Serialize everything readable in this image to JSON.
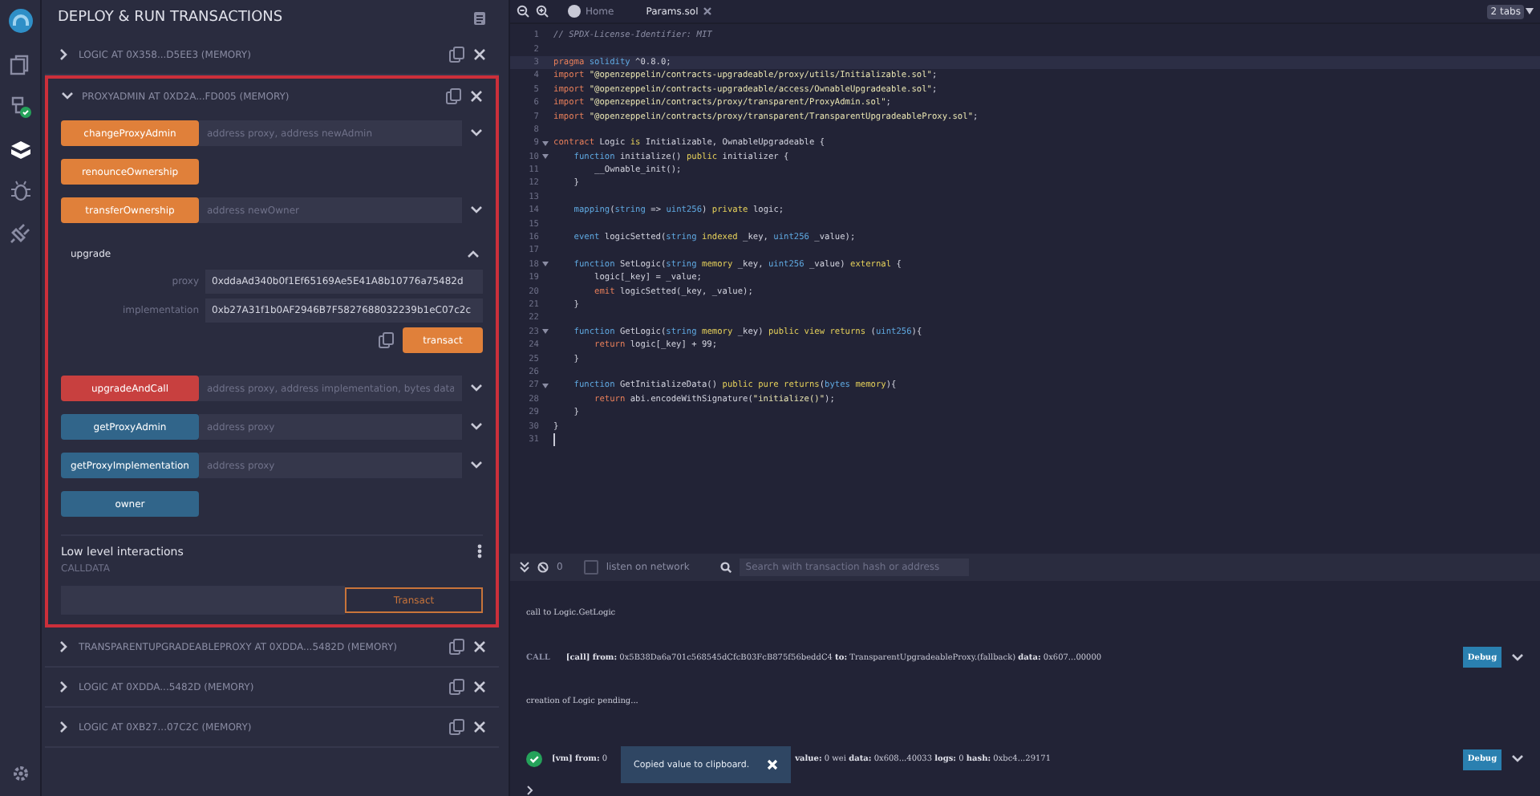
{
  "sidebar": {
    "items": [
      {
        "kind": "files",
        "selected": false
      },
      {
        "kind": "compiler",
        "selected": false
      },
      {
        "kind": "deploy",
        "selected": true
      },
      {
        "kind": "debugger",
        "selected": false
      },
      {
        "kind": "plugins",
        "selected": false
      }
    ]
  },
  "panel": {
    "title": "DEPLOY & RUN TRANSACTIONS",
    "instances": [
      {
        "title": "LOGIC AT 0X358...D5EE3 (MEMORY)",
        "expanded": false,
        "highlighted": false
      },
      {
        "title": "PROXYADMIN AT 0XD2A...FD005 (MEMORY)",
        "expanded": true,
        "highlighted": true,
        "functions": [
          {
            "name": "changeProxyAdmin",
            "kind": "transact",
            "placeholder": "address proxy, address newAdmin",
            "expanded": false
          },
          {
            "name": "renounceOwnership",
            "kind": "transact"
          },
          {
            "name": "transferOwnership",
            "kind": "transact",
            "placeholder": "address newOwner",
            "expanded": false
          },
          {
            "name": "upgrade",
            "kind": "transact",
            "expanded": true,
            "params": [
              {
                "label": "proxy",
                "value": "0xddaAd340b0f1Ef65169Ae5E41A8b10776a75482d"
              },
              {
                "label": "implementation",
                "value": "0xb27A31f1b0AF2946B7F5827688032239b1eC07c2c"
              }
            ],
            "action": "transact"
          },
          {
            "name": "upgradeAndCall",
            "kind": "payable",
            "placeholder": "address proxy, address implementation, bytes data",
            "expanded": false
          },
          {
            "name": "getProxyAdmin",
            "kind": "call",
            "placeholder": "address proxy",
            "expanded": false
          },
          {
            "name": "getProxyImplementation",
            "kind": "call",
            "placeholder": "address proxy",
            "expanded": false
          },
          {
            "name": "owner",
            "kind": "call"
          }
        ],
        "low_level": {
          "title": "Low level interactions",
          "calldata_label": "CALLDATA",
          "button": "Transact"
        }
      },
      {
        "title": "TRANSPARENTUPGRADEABLEPROXY AT 0XDDA...5482D (MEMORY)",
        "expanded": false,
        "highlighted": false
      },
      {
        "title": "LOGIC AT 0XDDA...5482D (MEMORY)",
        "expanded": false,
        "highlighted": false
      },
      {
        "title": "LOGIC AT 0XB27...07C2C (MEMORY)",
        "expanded": false,
        "highlighted": false
      }
    ]
  },
  "editor": {
    "tabs": [
      {
        "label": "Home",
        "kind": "home",
        "selected": false
      },
      {
        "label": "Params.sol",
        "kind": "file",
        "selected": true
      }
    ],
    "tab_count": "2 tabs",
    "lines": [
      {
        "number": "1",
        "segments": [
          {
            "kind": "comment",
            "text": "// SPDX-License-Identifier: MIT"
          }
        ]
      },
      {
        "number": "2"
      },
      {
        "number": "3",
        "active": true,
        "segments": [
          {
            "kind": "keyword",
            "text": "pragma "
          },
          {
            "kind": "type",
            "text": "solidity"
          },
          {
            "kind": "plain",
            "text": " ^0.8.0;"
          }
        ]
      },
      {
        "number": "4",
        "segments": [
          {
            "kind": "keyword",
            "text": "import "
          },
          {
            "kind": "string",
            "text": "\"@openzeppelin/contracts-upgradeable/proxy/utils/Initializable.sol\""
          },
          {
            "kind": "plain",
            "text": ";"
          }
        ]
      },
      {
        "number": "5",
        "segments": [
          {
            "kind": "keyword",
            "text": "import "
          },
          {
            "kind": "string",
            "text": "\"@openzeppelin/contracts-upgradeable/access/OwnableUpgradeable.sol\""
          },
          {
            "kind": "plain",
            "text": ";"
          }
        ]
      },
      {
        "number": "6",
        "segments": [
          {
            "kind": "keyword",
            "text": "import "
          },
          {
            "kind": "string",
            "text": "\"@openzeppelin/contracts/proxy/transparent/ProxyAdmin.sol\""
          },
          {
            "kind": "plain",
            "text": ";"
          }
        ]
      },
      {
        "number": "7",
        "segments": [
          {
            "kind": "keyword",
            "text": "import "
          },
          {
            "kind": "string",
            "text": "\"@openzeppelin/contracts/proxy/transparent/TransparentUpgradeableProxy.sol\""
          },
          {
            "kind": "plain",
            "text": ";"
          }
        ]
      },
      {
        "number": "8"
      },
      {
        "number": "9",
        "foldable": true,
        "segments": [
          {
            "kind": "keyword",
            "text": "contract "
          },
          {
            "kind": "plain",
            "text": "Logic "
          },
          {
            "kind": "modifier",
            "text": "is "
          },
          {
            "kind": "plain",
            "text": "Initializable, OwnableUpgradeable {"
          }
        ]
      },
      {
        "number": "10",
        "foldable": true,
        "segments": [
          {
            "kind": "type",
            "text": "    function "
          },
          {
            "kind": "plain",
            "text": "initialize() "
          },
          {
            "kind": "modifier",
            "text": "public "
          },
          {
            "kind": "plain",
            "text": "initializer {"
          }
        ]
      },
      {
        "number": "11",
        "segments": [
          {
            "kind": "plain",
            "text": "        __Ownable_init();"
          }
        ]
      },
      {
        "number": "12",
        "segments": [
          {
            "kind": "plain",
            "text": "    }"
          }
        ]
      },
      {
        "number": "13"
      },
      {
        "number": "14",
        "segments": [
          {
            "kind": "type",
            "text": "    mapping"
          },
          {
            "kind": "plain",
            "text": "("
          },
          {
            "kind": "type",
            "text": "string"
          },
          {
            "kind": "plain",
            "text": " => "
          },
          {
            "kind": "type",
            "text": "uint256"
          },
          {
            "kind": "plain",
            "text": ") "
          },
          {
            "kind": "modifier",
            "text": "private "
          },
          {
            "kind": "plain",
            "text": "logic;"
          }
        ]
      },
      {
        "number": "15"
      },
      {
        "number": "16",
        "segments": [
          {
            "kind": "type",
            "text": "    event "
          },
          {
            "kind": "plain",
            "text": "logicSetted("
          },
          {
            "kind": "type",
            "text": "string "
          },
          {
            "kind": "modifier",
            "text": "indexed "
          },
          {
            "kind": "plain",
            "text": "_key, "
          },
          {
            "kind": "type",
            "text": "uint256 "
          },
          {
            "kind": "plain",
            "text": "_value);"
          }
        ]
      },
      {
        "number": "17"
      },
      {
        "number": "18",
        "foldable": true,
        "segments": [
          {
            "kind": "type",
            "text": "    function "
          },
          {
            "kind": "plain",
            "text": "SetLogic("
          },
          {
            "kind": "type",
            "text": "string "
          },
          {
            "kind": "modifier",
            "text": "memory "
          },
          {
            "kind": "plain",
            "text": "_key, "
          },
          {
            "kind": "type",
            "text": "uint256 "
          },
          {
            "kind": "plain",
            "text": "_value) "
          },
          {
            "kind": "modifier",
            "text": "external "
          },
          {
            "kind": "plain",
            "text": "{"
          }
        ]
      },
      {
        "number": "19",
        "segments": [
          {
            "kind": "plain",
            "text": "        logic[_key] = _value;"
          }
        ]
      },
      {
        "number": "20",
        "segments": [
          {
            "kind": "keyword",
            "text": "        emit "
          },
          {
            "kind": "plain",
            "text": "logicSetted(_key, _value);"
          }
        ]
      },
      {
        "number": "21",
        "segments": [
          {
            "kind": "plain",
            "text": "    }"
          }
        ]
      },
      {
        "number": "22"
      },
      {
        "number": "23",
        "foldable": true,
        "segments": [
          {
            "kind": "type",
            "text": "    function "
          },
          {
            "kind": "plain",
            "text": "GetLogic("
          },
          {
            "kind": "type",
            "text": "string "
          },
          {
            "kind": "modifier",
            "text": "memory "
          },
          {
            "kind": "plain",
            "text": "_key) "
          },
          {
            "kind": "modifier",
            "text": "public view returns "
          },
          {
            "kind": "plain",
            "text": "("
          },
          {
            "kind": "type",
            "text": "uint256"
          },
          {
            "kind": "plain",
            "text": "){"
          }
        ]
      },
      {
        "number": "24",
        "segments": [
          {
            "kind": "keyword",
            "text": "        return "
          },
          {
            "kind": "plain",
            "text": "logic[_key] + 99;"
          }
        ]
      },
      {
        "number": "25",
        "segments": [
          {
            "kind": "plain",
            "text": "    }"
          }
        ]
      },
      {
        "number": "26"
      },
      {
        "number": "27",
        "foldable": true,
        "segments": [
          {
            "kind": "type",
            "text": "    function "
          },
          {
            "kind": "plain",
            "text": "GetInitializeData() "
          },
          {
            "kind": "modifier",
            "text": "public pure returns"
          },
          {
            "kind": "plain",
            "text": "("
          },
          {
            "kind": "type",
            "text": "bytes "
          },
          {
            "kind": "modifier",
            "text": "memory"
          },
          {
            "kind": "plain",
            "text": "){"
          }
        ]
      },
      {
        "number": "28",
        "segments": [
          {
            "kind": "keyword",
            "text": "        return "
          },
          {
            "kind": "plain",
            "text": "abi.encodeWithSignature("
          },
          {
            "kind": "string",
            "text": "\"initialize()\""
          },
          {
            "kind": "plain",
            "text": ");"
          }
        ]
      },
      {
        "number": "29",
        "segments": [
          {
            "kind": "plain",
            "text": "    }"
          }
        ]
      },
      {
        "number": "30",
        "segments": [
          {
            "kind": "plain",
            "text": "}"
          }
        ]
      },
      {
        "number": "31"
      }
    ]
  },
  "terminal": {
    "count": "0",
    "listen": {
      "label": "listen on network",
      "checked": false
    },
    "search": {
      "placeholder": "Search with transaction hash or address"
    },
    "entries": [
      {
        "kind": "log",
        "text": "call to Logic.GetLogic"
      },
      {
        "kind": "call",
        "badge": "CALL",
        "text": "**[call]** **from:** 0x5B38Da6a701c568545dCfcB03FcB875f56beddC4 **to:** TransparentUpgradeableProxy.(fallback) **data:** 0x607...00000",
        "button": "Debug"
      },
      {
        "kind": "log",
        "text": "creation of Logic pending..."
      },
      {
        "kind": "success",
        "text": "**[vm]** **from:** 0",
        "text_after": "**value:** 0 wei **data:** 0x608...40033 **logs:** 0 **hash:** 0xbc4...29171",
        "button": "Debug"
      }
    ],
    "toast": "Copied value to clipboard."
  }
}
